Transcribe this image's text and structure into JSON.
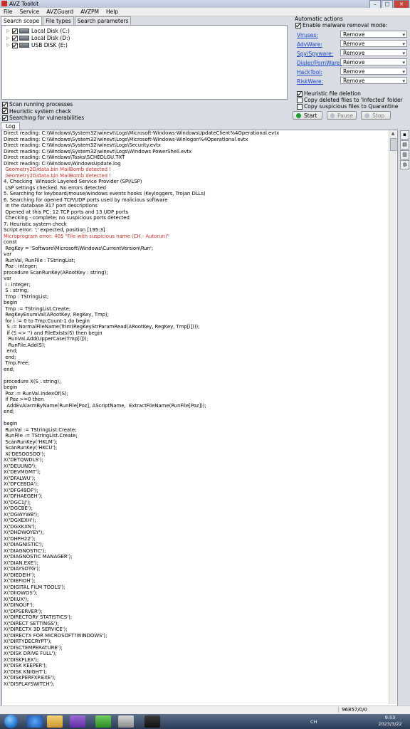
{
  "window": {
    "title": "AVZ Toolkit",
    "minimize": "–",
    "maximize": "□",
    "close": "✕"
  },
  "menu": [
    "File",
    "Service",
    "AVZGuard",
    "AVZPM",
    "Help"
  ],
  "tabs": [
    "Search scope",
    "File types",
    "Search parameters"
  ],
  "drives": [
    {
      "label": "Local Disk (C:)",
      "checked": true
    },
    {
      "label": "Local Disk (D:)",
      "checked": true
    },
    {
      "label": "USB DISK (E:)",
      "checked": true
    }
  ],
  "scan_options": [
    {
      "label": "Scan running processes",
      "checked": true
    },
    {
      "label": "Heuristic system check",
      "checked": true
    },
    {
      "label": "Searching for vulnerabilities",
      "checked": true
    }
  ],
  "automatic_actions": {
    "heading": "Automatic actions",
    "enable_label": "Enable malware removal mode:",
    "enable_checked": true,
    "rows": [
      {
        "label": "Viruses:",
        "value": "Remove"
      },
      {
        "label": "AdvWare:",
        "value": "Remove"
      },
      {
        "label": "Spy/Spyware:",
        "value": "Remove"
      },
      {
        "label": "Dialer/PornWare:",
        "value": "Remove"
      },
      {
        "label": "HackTool:",
        "value": "Remove"
      },
      {
        "label": "RiskWare:",
        "value": "Remove"
      }
    ],
    "extra_options": [
      {
        "label": "Heuristic file deletion",
        "checked": true
      },
      {
        "label": "Copy deleted files to 'Infected' folder",
        "checked": false
      },
      {
        "label": "Copy suspicious files to Quarantine",
        "checked": false
      }
    ]
  },
  "buttons": {
    "start": "Start",
    "pause": "Pause",
    "stop": "Stop"
  },
  "log_tab": "Log",
  "log_lines": [
    {
      "t": "Direct reading: C:\\Windows\\System32\\winevt\\Logs\\Microsoft-Windows-WindowsUpdateClient%4Operational.evtx",
      "c": ""
    },
    {
      "t": "Direct reading: C:\\Windows\\System32\\winevt\\Logs\\Microsoft-Windows-Winlogon%4Operational.evtx",
      "c": ""
    },
    {
      "t": "Direct reading: C:\\Windows\\System32\\winevt\\Logs\\Security.evtx",
      "c": ""
    },
    {
      "t": "Direct reading: C:\\Windows\\System32\\winevt\\Logs\\Windows PowerShell.evtx",
      "c": ""
    },
    {
      "t": "Direct reading: C:\\Windows\\Tasks\\SCHEDLGU.TXT",
      "c": ""
    },
    {
      "t": "Direct reading: C:\\Windows\\WindowsUpdate.log",
      "c": ""
    },
    {
      "t": " Geometry2D/data.bin MailBomb detected !",
      "c": "red"
    },
    {
      "t": " Geometry2D/data.bin MailBomb detected !",
      "c": "red"
    },
    {
      "t": "4. Checking  Winsock Layered Service Provider (SPI/LSP)",
      "c": ""
    },
    {
      "t": " LSP settings checked. No errors detected",
      "c": ""
    },
    {
      "t": "5. Searching for keyboard/mouse/windows events hooks (Keyloggers, Trojan DLLs)",
      "c": ""
    },
    {
      "t": "6. Searching for opened TCP/UDP ports used by malicious software",
      "c": ""
    },
    {
      "t": " In the database 317 port descriptions",
      "c": ""
    },
    {
      "t": " Opened at this PC: 12 TCP ports and 13 UDP ports",
      "c": ""
    },
    {
      "t": " Checking - complete; no suspicious ports detected",
      "c": ""
    },
    {
      "t": "7. Heuristic system check",
      "c": ""
    },
    {
      "t": "Script error: ';' expected, position [195:3]",
      "c": ""
    },
    {
      "t": "Microprogram error: 405 \"File with suspicious name (CH - Autorun)\"",
      "c": "red"
    },
    {
      "t": "const",
      "c": ""
    },
    {
      "t": " RegKey = 'Software\\Microsoft\\Windows\\CurrentVersion\\Run';",
      "c": ""
    },
    {
      "t": "var",
      "c": ""
    },
    {
      "t": " RunVal, RunFile : TStringList;",
      "c": ""
    },
    {
      "t": " Poz : integer;",
      "c": ""
    },
    {
      "t": "procedure ScanRunKey(ARootKey : string);",
      "c": ""
    },
    {
      "t": "var",
      "c": ""
    },
    {
      "t": " i : integer;",
      "c": ""
    },
    {
      "t": " S : string;",
      "c": ""
    },
    {
      "t": " Tmp : TStringList;",
      "c": ""
    },
    {
      "t": "begin",
      "c": ""
    },
    {
      "t": " Tmp := TStringList.Create;",
      "c": ""
    },
    {
      "t": " RegKeyEnumVal(ARootKey, RegKey, Tmp);",
      "c": ""
    },
    {
      "t": " for i := 0 to Tmp.Count-1 do begin",
      "c": ""
    },
    {
      "t": "  S := NormalFileName(Trim(RegKeyStrParamRead(ARootKey, RegKey, Tmp[i])));",
      "c": ""
    },
    {
      "t": "  if (S <> '') and FileExists(S) then begin",
      "c": ""
    },
    {
      "t": "   RunVal.Add(UpperCase(Tmp[i]));",
      "c": ""
    },
    {
      "t": "   RunFile.Add(S);",
      "c": ""
    },
    {
      "t": "  end;",
      "c": ""
    },
    {
      "t": " end;",
      "c": ""
    },
    {
      "t": " Tmp.Free;",
      "c": ""
    },
    {
      "t": "end;",
      "c": ""
    },
    {
      "t": "",
      "c": ""
    },
    {
      "t": "procedure X(S : string);",
      "c": ""
    },
    {
      "t": "begin",
      "c": ""
    },
    {
      "t": " Poz := RunVal.IndexOf(S);",
      "c": ""
    },
    {
      "t": " if Poz >=0 then",
      "c": ""
    },
    {
      "t": "  AddEvAlarmByName(RunFile[Poz], AScriptName,  ExtractFileName(RunFile[Poz]));",
      "c": ""
    },
    {
      "t": "end;",
      "c": ""
    },
    {
      "t": "",
      "c": ""
    },
    {
      "t": "begin",
      "c": ""
    },
    {
      "t": " RunVal := TStringList.Create;",
      "c": ""
    },
    {
      "t": " RunFile := TStringList.Create;",
      "c": ""
    },
    {
      "t": " ScanRunKey('HKLM');",
      "c": ""
    },
    {
      "t": " ScanRunKey('HKCU');",
      "c": ""
    },
    {
      "t": " X('DESOOSOO');",
      "c": ""
    },
    {
      "t": "X('DETQWDLS');",
      "c": ""
    },
    {
      "t": "X('DEUUNO');",
      "c": ""
    },
    {
      "t": "X('DEVMGMT');",
      "c": ""
    },
    {
      "t": "X('DFALWU');",
      "c": ""
    },
    {
      "t": "X('DFCEBDA');",
      "c": ""
    },
    {
      "t": "X('DFG49DF');",
      "c": ""
    },
    {
      "t": "X('DFHAEGEH');",
      "c": ""
    },
    {
      "t": "X('DGC1J');",
      "c": ""
    },
    {
      "t": "X('DGCBE');",
      "c": ""
    },
    {
      "t": "X('DGWYWB');",
      "c": ""
    },
    {
      "t": "X('DGXEXH');",
      "c": ""
    },
    {
      "t": "X('DGXKXN');",
      "c": ""
    },
    {
      "t": "X('DHDWOYEY');",
      "c": ""
    },
    {
      "t": "X('DHFH22');",
      "c": ""
    },
    {
      "t": "X('DIAGNISTIC');",
      "c": ""
    },
    {
      "t": "X('DIAGNOSTIC');",
      "c": ""
    },
    {
      "t": "X('DIAGNOSTIC MANAGER');",
      "c": ""
    },
    {
      "t": "X('DIAN.EXE');",
      "c": ""
    },
    {
      "t": "X('DIAYSOTG');",
      "c": ""
    },
    {
      "t": "X('DIEDEIH');",
      "c": ""
    },
    {
      "t": "X('DIEFIOH');",
      "c": ""
    },
    {
      "t": "X('DIGITAL FILM TOOLS');",
      "c": ""
    },
    {
      "t": "X('DIIOWOS');",
      "c": ""
    },
    {
      "t": "X('DIIUX');",
      "c": ""
    },
    {
      "t": "X('DINOUF');",
      "c": ""
    },
    {
      "t": "X('DIPSERVER');",
      "c": ""
    },
    {
      "t": "X('DIRECTORY STATISTICS');",
      "c": ""
    },
    {
      "t": "X('DIRECT SETTINGS');",
      "c": ""
    },
    {
      "t": "X('DIRECTX 3D SERVICE');",
      "c": ""
    },
    {
      "t": "X('DIRECTX FOR MICROSOFT?WINDOWS');",
      "c": ""
    },
    {
      "t": "X('DIRTYDECRYPT');",
      "c": ""
    },
    {
      "t": "X('DISCTEMPERATURE');",
      "c": ""
    },
    {
      "t": "X('DISK DRIVE FULL');",
      "c": ""
    },
    {
      "t": "X('DISKFLEX');",
      "c": ""
    },
    {
      "t": "X('DISK KEEPER');",
      "c": ""
    },
    {
      "t": "X('DISK KNIGHT');",
      "c": ""
    },
    {
      "t": "X('DISKPERFXP.EXE');",
      "c": ""
    },
    {
      "t": "X('DISPLAYSWITCH');",
      "c": ""
    }
  ],
  "status": {
    "counter": "96857/0/0"
  },
  "tray": {
    "lang": "CH",
    "time": "9:53",
    "date": "2023/3/22"
  },
  "colors": {
    "link": "#1a44c8",
    "alert_text": "#c4302a",
    "start_dot": "#1f9a2e"
  }
}
